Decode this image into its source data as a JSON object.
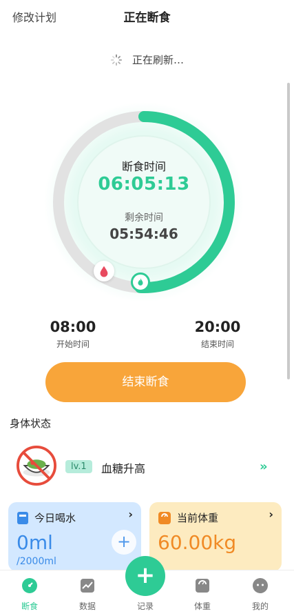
{
  "header": {
    "left_action": "修改计划",
    "title": "正在断食"
  },
  "refresh": {
    "text": "正在刷新…"
  },
  "timer": {
    "elapsed_label": "断食时间",
    "elapsed": "06:05:13",
    "remaining_label": "剩余时间",
    "remaining": "05:54:46",
    "progress": 0.507
  },
  "schedule": {
    "start_time": "08:00",
    "start_label": "开始时间",
    "end_time": "20:00",
    "end_label": "结束时间"
  },
  "end_button": "结束断食",
  "body_status": {
    "section_title": "身体状态",
    "level": "lv.1",
    "text": "血糖升高"
  },
  "water_card": {
    "title": "今日喝水",
    "value": "0ml",
    "goal": "/2000ml"
  },
  "weight_card": {
    "title": "当前体重",
    "value": "60.00kg"
  },
  "tabs": {
    "fasting": "断食",
    "data": "数据",
    "record": "记录",
    "weight": "体重",
    "mine": "我的"
  },
  "colors": {
    "accent": "#2ecb95",
    "orange": "#f8a53a",
    "water_bg": "#d3e8ff",
    "weight_bg": "#fdebc0"
  }
}
